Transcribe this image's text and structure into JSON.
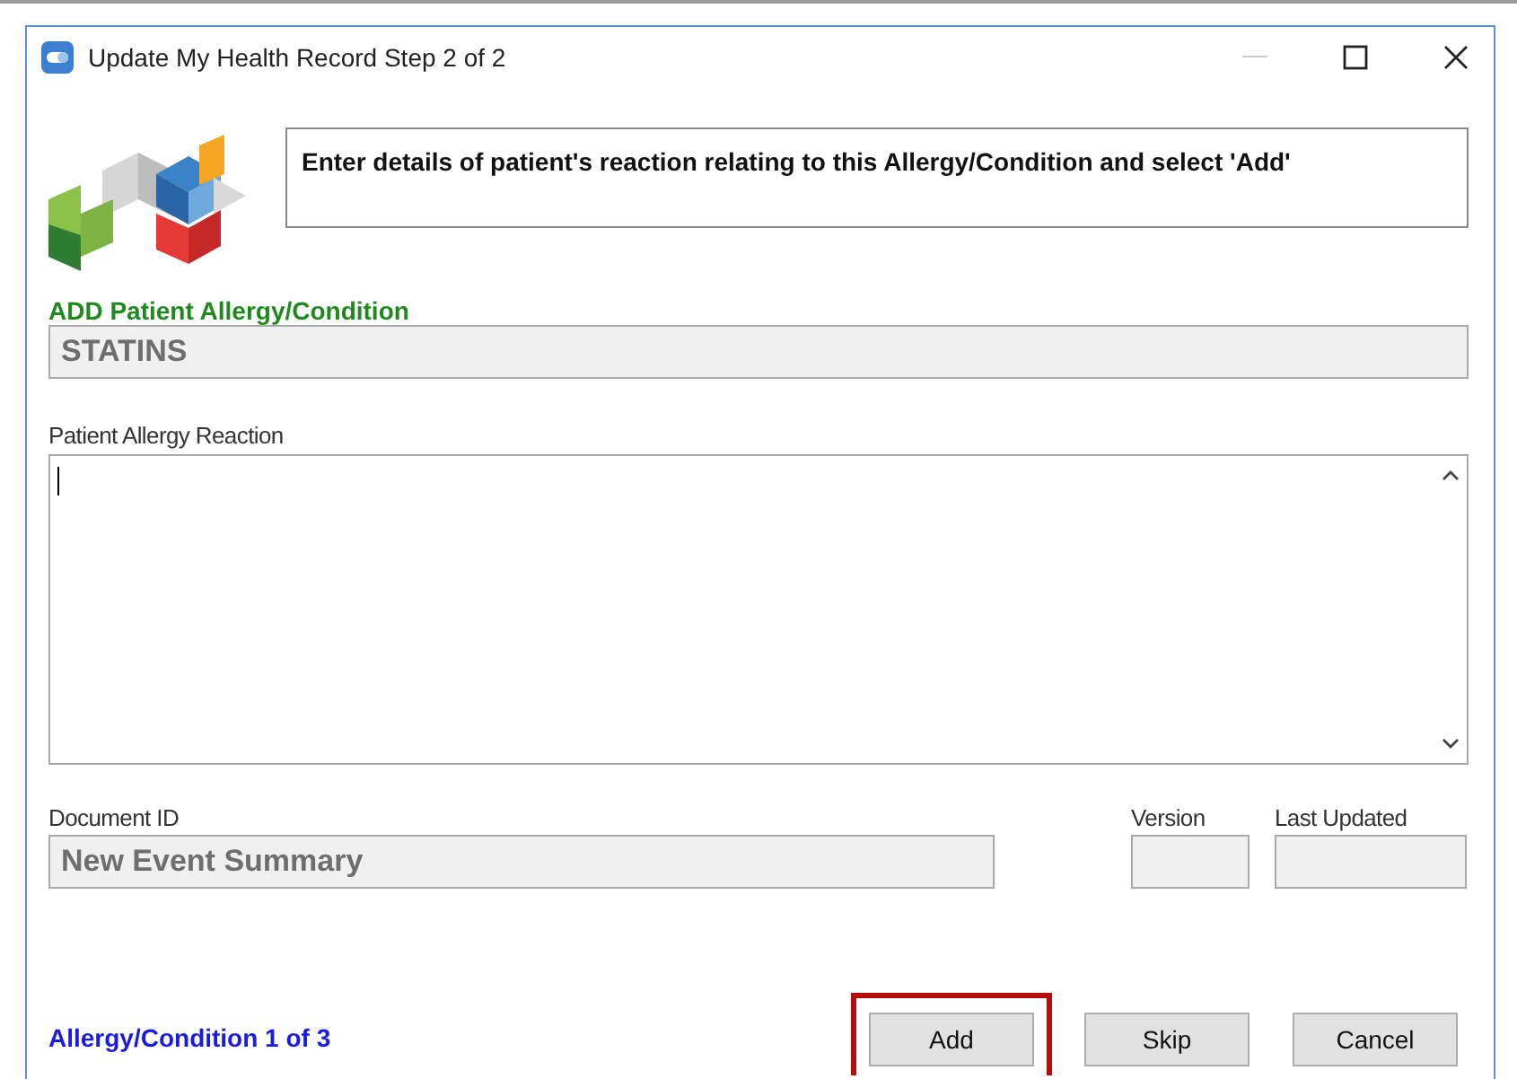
{
  "window": {
    "title": "Update My Health Record Step 2 of 2"
  },
  "instruction": "Enter details of patient's reaction relating to this Allergy/Condition and select 'Add'",
  "allergy": {
    "label": "ADD Patient Allergy/Condition",
    "value": "STATINS"
  },
  "reaction": {
    "label": "Patient Allergy Reaction"
  },
  "document": {
    "label": "Document ID",
    "value": "New Event Summary"
  },
  "version": {
    "label": "Version"
  },
  "last_updated": {
    "label": "Last Updated"
  },
  "progress": "Allergy/Condition 1 of 3",
  "buttons": [
    {
      "label": "Add",
      "highlighted": true
    },
    {
      "label": "Skip",
      "highlighted": false
    },
    {
      "label": "Cancel",
      "highlighted": false
    }
  ]
}
